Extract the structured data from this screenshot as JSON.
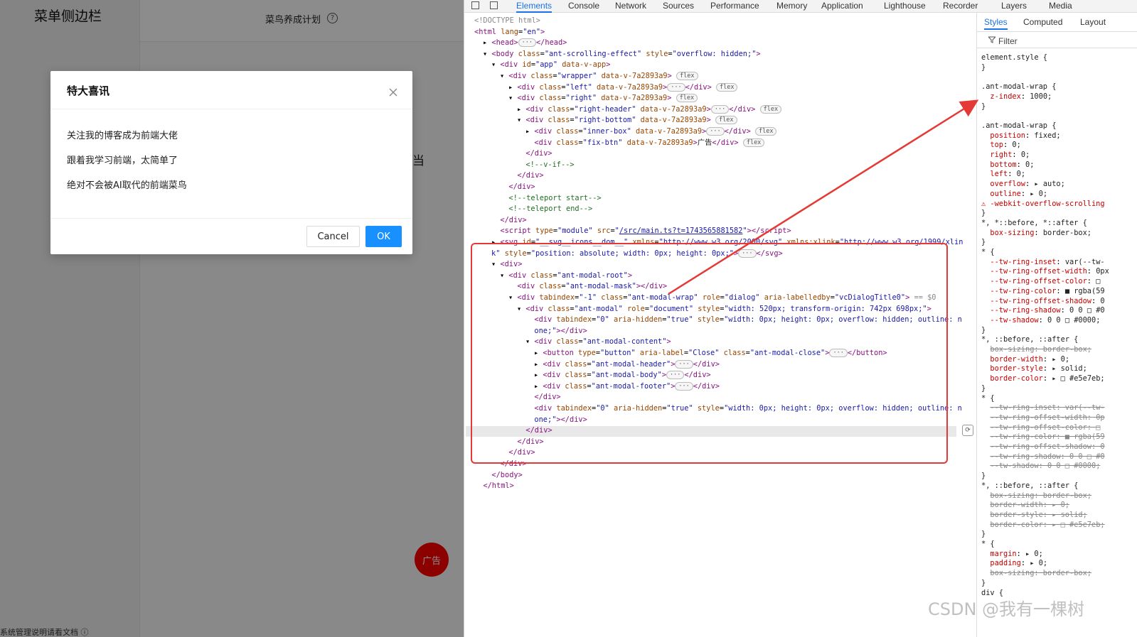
{
  "app": {
    "sidebar_title": "菜单侧边栏",
    "sidebar_bottom_text": "系统管理说明请看文档 ⓘ",
    "header_title": "菜鸟养成计划",
    "partial_char": "当",
    "fix_btn_label": "广告",
    "modal": {
      "title": "特大喜讯",
      "lines": [
        "关注我的博客成为前端大佬",
        "跟着我学习前端，太简单了",
        "绝对不会被AI取代的前端菜鸟"
      ],
      "cancel_label": "Cancel",
      "ok_label": "OK"
    }
  },
  "devtools": {
    "tabs": [
      "Elements",
      "Console",
      "Network",
      "Sources",
      "Performance",
      "Memory",
      "Application",
      "Lighthouse",
      "Recorder",
      "Layers",
      "Media"
    ],
    "active_tab": "Elements",
    "styles_tabs": [
      "Styles",
      "Computed",
      "Layout"
    ],
    "active_styles_tab": "Styles",
    "filter_label": "Filter",
    "dom_lines": [
      {
        "indent": 0,
        "html": "<span class='gray'>&lt;!DOCTYPE html&gt;</span>"
      },
      {
        "indent": 0,
        "html": "<span class='tag'>&lt;html</span> <span class='attr'>lang</span>=<span class='val'>\"en\"</span><span class='tag'>&gt;</span>"
      },
      {
        "indent": 1,
        "html": "▸ <span class='tag'>&lt;head&gt;</span><span class='pill'>···</span><span class='tag'>&lt;/head&gt;</span>"
      },
      {
        "indent": 1,
        "html": "▾ <span class='tag'>&lt;body</span> <span class='attr'>class</span>=<span class='val'>\"ant-scrolling-effect\"</span> <span class='attr'>style</span>=<span class='val'>\"overflow: hidden;\"</span><span class='tag'>&gt;</span>"
      },
      {
        "indent": 2,
        "html": "▾ <span class='tag'>&lt;div</span> <span class='attr'>id</span>=<span class='val'>\"app\"</span> <span class='attr'>data-v-app</span><span class='tag'>&gt;</span>"
      },
      {
        "indent": 3,
        "html": "▾ <span class='tag'>&lt;div</span> <span class='attr'>class</span>=<span class='val'>\"wrapper\"</span> <span class='attr'>data-v-7a2893a9</span><span class='tag'>&gt;</span> <span class='pill'>flex</span>"
      },
      {
        "indent": 4,
        "html": "▸ <span class='tag'>&lt;div</span> <span class='attr'>class</span>=<span class='val'>\"left\"</span> <span class='attr'>data-v-7a2893a9</span><span class='tag'>&gt;</span><span class='pill'>···</span><span class='tag'>&lt;/div&gt;</span> <span class='pill'>flex</span>"
      },
      {
        "indent": 4,
        "html": "▾ <span class='tag'>&lt;div</span> <span class='attr'>class</span>=<span class='val'>\"right\"</span> <span class='attr'>data-v-7a2893a9</span><span class='tag'>&gt;</span> <span class='pill'>flex</span>"
      },
      {
        "indent": 5,
        "html": "▸ <span class='tag'>&lt;div</span> <span class='attr'>class</span>=<span class='val'>\"right-header\"</span> <span class='attr'>data-v-7a2893a9</span><span class='tag'>&gt;</span><span class='pill'>···</span><span class='tag'>&lt;/div&gt;</span> <span class='pill'>flex</span>"
      },
      {
        "indent": 5,
        "html": "▾ <span class='tag'>&lt;div</span> <span class='attr'>class</span>=<span class='val'>\"right-bottom\"</span> <span class='attr'>data-v-7a2893a9</span><span class='tag'>&gt;</span> <span class='pill'>flex</span>"
      },
      {
        "indent": 6,
        "html": "▸ <span class='tag'>&lt;div</span> <span class='attr'>class</span>=<span class='val'>\"inner-box\"</span> <span class='attr'>data-v-7a2893a9</span><span class='tag'>&gt;</span><span class='pill'>···</span><span class='tag'>&lt;/div&gt;</span> <span class='pill'>flex</span>"
      },
      {
        "indent": 6,
        "html": "  <span class='tag'>&lt;div</span> <span class='attr'>class</span>=<span class='val'>\"fix-btn\"</span> <span class='attr'>data-v-7a2893a9</span><span class='tag'>&gt;</span><span class='txt'>广告</span><span class='tag'>&lt;/div&gt;</span> <span class='pill'>flex</span>"
      },
      {
        "indent": 5,
        "html": "  <span class='tag'>&lt;/div&gt;</span>"
      },
      {
        "indent": 5,
        "html": "  <span class='cmt'>&lt;!--v-if--&gt;</span>"
      },
      {
        "indent": 4,
        "html": "  <span class='tag'>&lt;/div&gt;</span>"
      },
      {
        "indent": 3,
        "html": "  <span class='tag'>&lt;/div&gt;</span>"
      },
      {
        "indent": 3,
        "html": "  <span class='cmt'>&lt;!--teleport start--&gt;</span>"
      },
      {
        "indent": 3,
        "html": "  <span class='cmt'>&lt;!--teleport end--&gt;</span>"
      },
      {
        "indent": 2,
        "html": "  <span class='tag'>&lt;/div&gt;</span>"
      },
      {
        "indent": 2,
        "html": "  <span class='tag'>&lt;script</span> <span class='attr'>type</span>=<span class='val'>\"module\"</span> <span class='attr'>src</span>=<span class='val'>\"<span class='link'>/src/main.ts?t=1743565881582</span>\"</span><span class='tag'>&gt;&lt;/script&gt;</span>"
      },
      {
        "indent": 2,
        "html": "▸ <span class='tag'>&lt;svg</span> <span class='attr'>id</span>=<span class='val'>\"__svg__icons__dom__\"</span> <span class='attr'>xmlns</span>=<span class='val'>\"http://www.w3.org/2000/svg\"</span> <span class='attr'>xmlns:xlink</span>=<span class='val'>\"http://www.w3.org/1999/xlin</span>"
      },
      {
        "indent": 2,
        "html": "<span class='val'>k\"</span> <span class='attr'>style</span>=<span class='val'>\"position: absolute; width: 0px; height: 0px;\"</span><span class='tag'>&gt;</span><span class='pill'>···</span><span class='tag'>&lt;/svg&gt;</span>"
      },
      {
        "indent": 2,
        "html": "▾ <span class='tag'>&lt;div&gt;</span>"
      },
      {
        "indent": 3,
        "html": "▾ <span class='tag'>&lt;div</span> <span class='attr'>class</span>=<span class='val'>\"ant-modal-root\"</span><span class='tag'>&gt;</span>"
      },
      {
        "indent": 4,
        "html": "  <span class='tag'>&lt;div</span> <span class='attr'>class</span>=<span class='val'>\"ant-modal-mask\"</span><span class='tag'>&gt;&lt;/div&gt;</span>"
      },
      {
        "indent": 4,
        "html": "▾ <span class='tag'>&lt;div</span> <span class='attr'>tabindex</span>=<span class='val'>\"-1\"</span> <span class='attr'>class</span>=<span class='val'>\"ant-modal-wrap\"</span> <span class='attr'>role</span>=<span class='val'>\"dialog\"</span> <span class='attr'>aria-labelledby</span>=<span class='val'>\"vcDialogTitle0\"</span><span class='tag'>&gt;</span> <span class='gray'>== $0</span>"
      },
      {
        "indent": 5,
        "html": "▾ <span class='tag'>&lt;div</span> <span class='attr'>class</span>=<span class='val'>\"ant-modal\"</span> <span class='attr'>role</span>=<span class='val'>\"document\"</span> <span class='attr'>style</span>=<span class='val'>\"width: 520px; transform-origin: 742px 698px;\"</span><span class='tag'>&gt;</span>"
      },
      {
        "indent": 6,
        "html": "  <span class='tag'>&lt;div</span> <span class='attr'>tabindex</span>=<span class='val'>\"0\"</span> <span class='attr'>aria-hidden</span>=<span class='val'>\"true\"</span> <span class='attr'>style</span>=<span class='val'>\"width: 0px; height: 0px; overflow: hidden; outline: n</span>"
      },
      {
        "indent": 6,
        "html": "  <span class='val'>one;\"</span><span class='tag'>&gt;&lt;/div&gt;</span>"
      },
      {
        "indent": 6,
        "html": "▾ <span class='tag'>&lt;div</span> <span class='attr'>class</span>=<span class='val'>\"ant-modal-content\"</span><span class='tag'>&gt;</span>"
      },
      {
        "indent": 7,
        "html": "▸ <span class='tag'>&lt;button</span> <span class='attr'>type</span>=<span class='val'>\"button\"</span> <span class='attr'>aria-label</span>=<span class='val'>\"Close\"</span> <span class='attr'>class</span>=<span class='val'>\"ant-modal-close\"</span><span class='tag'>&gt;</span><span class='pill'>···</span><span class='tag'>&lt;/button&gt;</span>"
      },
      {
        "indent": 7,
        "html": "▸ <span class='tag'>&lt;div</span> <span class='attr'>class</span>=<span class='val'>\"ant-modal-header\"</span><span class='tag'>&gt;</span><span class='pill'>···</span><span class='tag'>&lt;/div&gt;</span>"
      },
      {
        "indent": 7,
        "html": "▸ <span class='tag'>&lt;div</span> <span class='attr'>class</span>=<span class='val'>\"ant-modal-body\"</span><span class='tag'>&gt;</span><span class='pill'>···</span><span class='tag'>&lt;/div&gt;</span>"
      },
      {
        "indent": 7,
        "html": "▸ <span class='tag'>&lt;div</span> <span class='attr'>class</span>=<span class='val'>\"ant-modal-footer\"</span><span class='tag'>&gt;</span><span class='pill'>···</span><span class='tag'>&lt;/div&gt;</span>"
      },
      {
        "indent": 6,
        "html": "  <span class='tag'>&lt;/div&gt;</span>"
      },
      {
        "indent": 6,
        "html": "  <span class='tag'>&lt;div</span> <span class='attr'>tabindex</span>=<span class='val'>\"0\"</span> <span class='attr'>aria-hidden</span>=<span class='val'>\"true\"</span> <span class='attr'>style</span>=<span class='val'>\"width: 0px; height: 0px; overflow: hidden; outline: n</span>"
      },
      {
        "indent": 6,
        "html": "  <span class='val'>one;\"</span><span class='tag'>&gt;&lt;/div&gt;</span>"
      },
      {
        "indent": 5,
        "html": "  <span class='tag'>&lt;/div&gt;</span>"
      },
      {
        "indent": 4,
        "html": "  <span class='tag'>&lt;/div&gt;</span>"
      },
      {
        "indent": 3,
        "html": "  <span class='tag'>&lt;/div&gt;</span>"
      },
      {
        "indent": 2,
        "html": "  <span class='tag'>&lt;/div&gt;</span>"
      },
      {
        "indent": 1,
        "html": "  <span class='tag'>&lt;/body&gt;</span>"
      },
      {
        "indent": 0,
        "html": "  <span class='tag'>&lt;/html&gt;</span>"
      }
    ],
    "styles_lines": [
      "<span class='sel'>element.style {</span>",
      "<span class='sel'>}</span>",
      "",
      "<span class='sel'>.ant-modal-wrap {</span>",
      "  <span class='prop'>z-index</span>: <span class='pval'>1000;</span>",
      "<span class='sel'>}</span>",
      "",
      "<span class='sel'>.ant-modal-wrap {</span>",
      "  <span class='prop'>position</span>: <span class='pval'>fixed;</span>",
      "  <span class='prop'>top</span>: <span class='pval'>0;</span>",
      "  <span class='prop'>right</span>: <span class='pval'>0;</span>",
      "  <span class='prop'>bottom</span>: <span class='pval'>0;</span>",
      "  <span class='prop'>left</span>: <span class='pval'>0;</span>",
      "  <span class='prop'>overflow</span>: <span class='pval'>▸ auto;</span>",
      "  <span class='prop'>outline</span>: <span class='pval'>▸ 0;</span>",
      "<span class='prop'>⚠ -webkit-overflow-scrolling</span>",
      "<span class='sel'>}</span>",
      "<span class='sel'>*, *::before, *::after {</span>",
      "  <span class='prop'>box-sizing</span>: <span class='pval'>border-box;</span>",
      "<span class='sel'>}</span>",
      "<span class='sel'>* {</span>",
      "  <span class='prop'>--tw-ring-inset</span>: <span class='pval'>var(--tw-</span>",
      "  <span class='prop'>--tw-ring-offset-width</span>: <span class='pval'>0px</span>",
      "  <span class='prop'>--tw-ring-offset-color</span>: <span class='pval'>□</span>",
      "  <span class='prop'>--tw-ring-color</span>: <span class='pval'>■ rgba(59</span>",
      "  <span class='prop'>--tw-ring-offset-shadow</span>: <span class='pval'>0</span>",
      "  <span class='prop'>--tw-ring-shadow</span>: <span class='pval'>0 0 □ #0</span>",
      "  <span class='prop'>--tw-shadow</span>: <span class='pval'>0 0 □ #0000;</span>",
      "<span class='sel'>}</span>",
      "<span class='sel'>*, ::before, ::after {</span>",
      "  <span class='strike'>box-sizing: border-box;</span>",
      "  <span class='prop'>border-width</span>: <span class='pval'>▸ 0;</span>",
      "  <span class='prop'>border-style</span>: <span class='pval'>▸ solid;</span>",
      "  <span class='prop'>border-color</span>: <span class='pval'>▸ □ #e5e7eb;</span>",
      "<span class='sel'>}</span>",
      "<span class='sel'>* {</span>",
      "  <span class='strike'>--tw-ring-inset: var(--tw-</span>",
      "  <span class='strike'>--tw-ring-offset-width: 0p</span>",
      "  <span class='strike'>--tw-ring-offset-color: □</span>",
      "  <span class='strike'>--tw-ring-color: ■ rgba(59</span>",
      "  <span class='strike'>--tw-ring-offset-shadow: 0</span>",
      "  <span class='strike'>--tw-ring-shadow: 0 0 □ #0</span>",
      "  <span class='strike'>--tw-shadow: 0 0 □ #0000;</span>",
      "<span class='sel'>}</span>",
      "<span class='sel'>*, ::before, ::after {</span>",
      "  <span class='strike'>box-sizing: border-box;</span>",
      "  <span class='strike'>border-width: ▸ 0;</span>",
      "  <span class='strike'>border-style: ▸ solid;</span>",
      "  <span class='strike'>border-color: ▸ □ #e5e7eb;</span>",
      "<span class='sel'>}</span>",
      "<span class='sel'>* {</span>",
      "  <span class='prop'>margin</span>: <span class='pval'>▸ 0;</span>",
      "  <span class='prop'>padding</span>: <span class='pval'>▸ 0;</span>",
      "  <span class='strike'>box-sizing: border-box;</span>",
      "<span class='sel'>}</span>",
      "<span class='sel'>div {</span>"
    ]
  },
  "watermark": "CSDN @我有一棵树",
  "colors": {
    "ok_button": "#1890ff",
    "fix_button": "#ff0000",
    "annotation_red": "#e53935",
    "active_tab": "#1a73e8"
  }
}
